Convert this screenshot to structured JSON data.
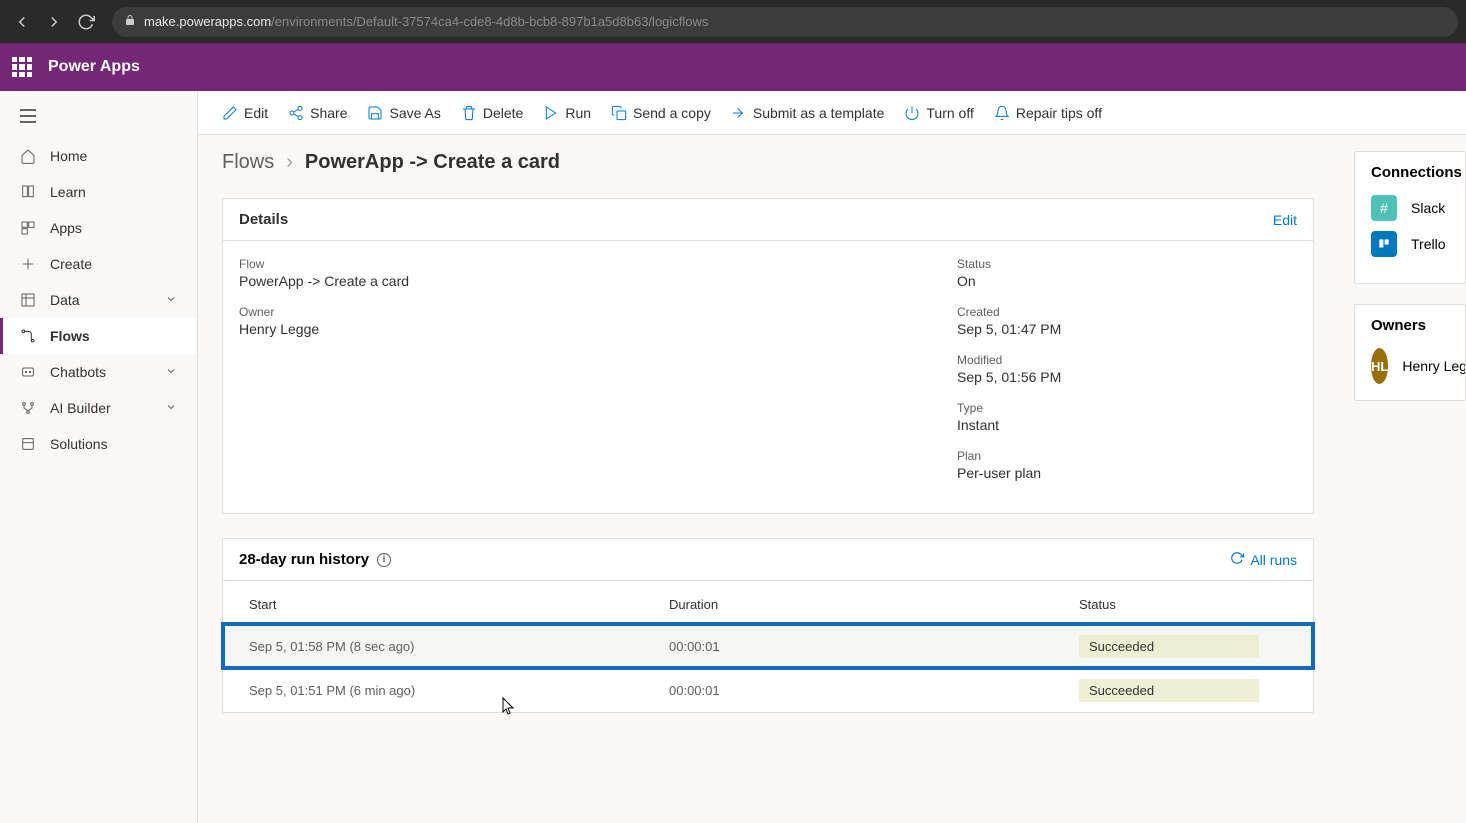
{
  "browser": {
    "domain": "make.powerapps.com",
    "path": "/environments/Default-37574ca4-cde8-4d8b-bcb8-897b1a5d8b63/logicflows"
  },
  "header": {
    "app_name": "Power Apps"
  },
  "sidebar": {
    "items": [
      {
        "label": "Home"
      },
      {
        "label": "Learn"
      },
      {
        "label": "Apps"
      },
      {
        "label": "Create"
      },
      {
        "label": "Data"
      },
      {
        "label": "Flows"
      },
      {
        "label": "Chatbots"
      },
      {
        "label": "AI Builder"
      },
      {
        "label": "Solutions"
      }
    ]
  },
  "toolbar": {
    "edit": "Edit",
    "share": "Share",
    "save_as": "Save As",
    "delete": "Delete",
    "run": "Run",
    "send_copy": "Send a copy",
    "submit_template": "Submit as a template",
    "turn_off": "Turn off",
    "repair_tips": "Repair tips off"
  },
  "breadcrumb": {
    "root": "Flows",
    "current": "PowerApp -> Create a card"
  },
  "details": {
    "title": "Details",
    "edit_link": "Edit",
    "flow_label": "Flow",
    "flow_value": "PowerApp -> Create a card",
    "owner_label": "Owner",
    "owner_value": "Henry Legge",
    "status_label": "Status",
    "status_value": "On",
    "created_label": "Created",
    "created_value": "Sep 5, 01:47 PM",
    "modified_label": "Modified",
    "modified_value": "Sep 5, 01:56 PM",
    "type_label": "Type",
    "type_value": "Instant",
    "plan_label": "Plan",
    "plan_value": "Per-user plan"
  },
  "history": {
    "title": "28-day run history",
    "all_runs": "All runs",
    "columns": {
      "start": "Start",
      "duration": "Duration",
      "status": "Status"
    },
    "rows": [
      {
        "start": "Sep 5, 01:58 PM (8 sec ago)",
        "duration": "00:00:01",
        "status": "Succeeded"
      },
      {
        "start": "Sep 5, 01:51 PM (6 min ago)",
        "duration": "00:00:01",
        "status": "Succeeded"
      }
    ]
  },
  "connections": {
    "title": "Connections",
    "items": [
      {
        "label": "Slack"
      },
      {
        "label": "Trello"
      }
    ]
  },
  "owners": {
    "title": "Owners",
    "initials": "HL",
    "name": "Henry Legge"
  }
}
